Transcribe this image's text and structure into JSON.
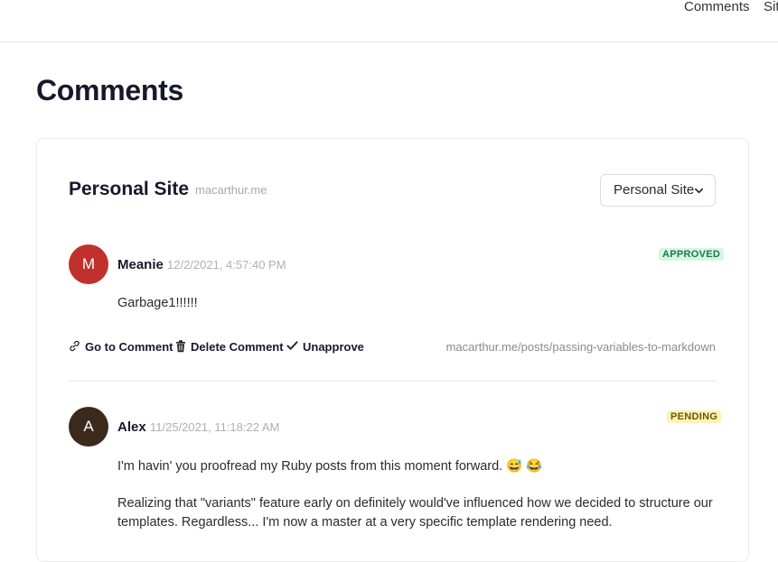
{
  "nav": {
    "items": [
      {
        "label": "Comments"
      },
      {
        "label": "Sit"
      }
    ]
  },
  "page": {
    "title": "Comments"
  },
  "site_card": {
    "title": "Personal Site",
    "domain": "macarthur.me",
    "selector_value": "Personal Site"
  },
  "comments": [
    {
      "initial": "M",
      "avatar_color": "#c0312b",
      "author": "Meanie",
      "timestamp": "12/2/2021, 4:57:40 PM",
      "status": "APPROVED",
      "status_bg": "#d6f5e3",
      "status_fg": "#1f7a45",
      "body": [
        "Garbage1!!!!!!"
      ],
      "actions": {
        "go_to": "Go to Comment",
        "delete": "Delete Comment",
        "toggle": "Unapprove"
      },
      "post_url": "macarthur.me/posts/passing-variables-to-markdown"
    },
    {
      "initial": "A",
      "avatar_color": "#3b2a1c",
      "author": "Alex",
      "timestamp": "11/25/2021, 11:18:22 AM",
      "status": "PENDING",
      "status_bg": "#fbf3b8",
      "status_fg": "#6b5800",
      "body": [
        "I'm havin' you proofread my Ruby posts from this moment forward. 😅 😂",
        "Realizing that \"variants\" feature early on definitely would've influenced how we decided to structure our",
        "templates. Regardless... I'm now a master at a very specific template rendering need."
      ]
    }
  ],
  "colors": {
    "approved": "#d6f5e3",
    "pending": "#fbf3b8",
    "title": "#16192b"
  },
  "icons": [
    "link-icon",
    "trash-icon",
    "check-icon",
    "chevron-down-icon"
  ]
}
